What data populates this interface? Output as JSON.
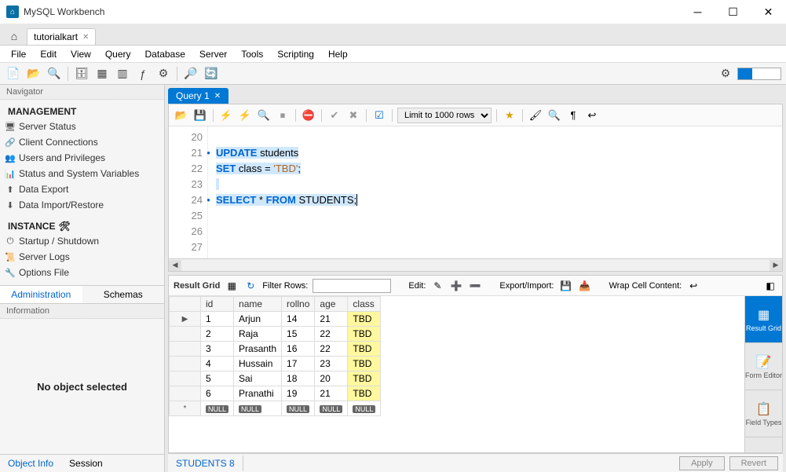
{
  "app": {
    "title": "MySQL Workbench"
  },
  "top_tab": {
    "label": "tutorialkart"
  },
  "menu": [
    "File",
    "Edit",
    "View",
    "Query",
    "Database",
    "Server",
    "Tools",
    "Scripting",
    "Help"
  ],
  "navigator": {
    "header": "Navigator",
    "management": {
      "title": "MANAGEMENT",
      "items": [
        "Server Status",
        "Client Connections",
        "Users and Privileges",
        "Status and System Variables",
        "Data Export",
        "Data Import/Restore"
      ]
    },
    "instance": {
      "title": "INSTANCE",
      "items": [
        "Startup / Shutdown",
        "Server Logs",
        "Options File"
      ]
    },
    "tabs": [
      "Administration",
      "Schemas"
    ],
    "info_header": "Information",
    "info_body": "No object selected",
    "info_tabs": [
      "Object Info",
      "Session"
    ]
  },
  "query_tab": "Query 1",
  "limit": "Limit to 1000 rows",
  "code": {
    "lines": [
      20,
      21,
      22,
      23,
      24,
      25,
      26,
      27
    ],
    "dots": [
      21,
      24
    ],
    "l21_kw1": "UPDATE",
    "l21_id": " students",
    "l22_kw1": "SET",
    "l22_txt": " class = ",
    "l22_str": "'TBD'",
    "l22_end": ";",
    "l24_kw1": "SELECT",
    "l24_star": " * ",
    "l24_kw2": "FROM",
    "l24_id": " STUDENTS",
    "l24_end": ";"
  },
  "results": {
    "label": "Result Grid",
    "filter_label": "Filter Rows:",
    "edit_label": "Edit:",
    "export_label": "Export/Import:",
    "wrap_label": "Wrap Cell Content:",
    "columns": [
      "id",
      "name",
      "rollno",
      "age",
      "class"
    ],
    "rows": [
      {
        "id": "1",
        "name": "Arjun",
        "rollno": "14",
        "age": "21",
        "class": "TBD"
      },
      {
        "id": "2",
        "name": "Raja",
        "rollno": "15",
        "age": "22",
        "class": "TBD"
      },
      {
        "id": "3",
        "name": "Prasanth",
        "rollno": "16",
        "age": "22",
        "class": "TBD"
      },
      {
        "id": "4",
        "name": "Hussain",
        "rollno": "17",
        "age": "23",
        "class": "TBD"
      },
      {
        "id": "5",
        "name": "Sai",
        "rollno": "18",
        "age": "20",
        "class": "TBD"
      },
      {
        "id": "6",
        "name": "Pranathi",
        "rollno": "19",
        "age": "21",
        "class": "TBD"
      }
    ],
    "null": "NULL",
    "side_tabs": [
      "Result Grid",
      "Form Editor",
      "Field Types"
    ],
    "bottom_tab": "STUDENTS 8",
    "apply": "Apply",
    "revert": "Revert"
  }
}
